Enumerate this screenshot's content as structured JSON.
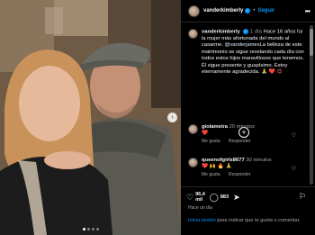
{
  "header": {
    "username": "vanderkimberly",
    "separator": "•",
    "follow_label": "Seguir",
    "more_icon": "more-icon"
  },
  "caption": {
    "username": "vanderkimberly",
    "time": "1 día",
    "text_before": "Hace 16 años fui la mujer más afortunada del mundo al casarme.",
    "mention": "@vanderjames",
    "text_after": "La belleza de este matrimonio se sigue revelando cada día con todos estos hijos maravillosos que tenemos. Él sigue presente y guapísimo. Estoy eternamente agradecida.",
    "emojis": "🙏 ❤️ 😍"
  },
  "comments": [
    {
      "username": "giolameira",
      "time": "20 minutos",
      "text": "❤️",
      "like_label": "Me gusta",
      "reply_label": "Responder"
    },
    {
      "username": "queenofgirls8677",
      "time": "30 minutos",
      "text": "❤️ 🙌 🔥 🙏",
      "like_label": "Me gusta",
      "reply_label": "Responder"
    }
  ],
  "actions": {
    "likes_count": "96,4",
    "likes_unit": "mil",
    "comments_count": "883",
    "posted": "Hace un día"
  },
  "login_prompt": {
    "link": "Inicia sesión",
    "rest": " para indicar que te gusta o comentar."
  },
  "colors": {
    "accent": "#0095f6",
    "background": "#000000",
    "muted": "#a8a8a8"
  }
}
